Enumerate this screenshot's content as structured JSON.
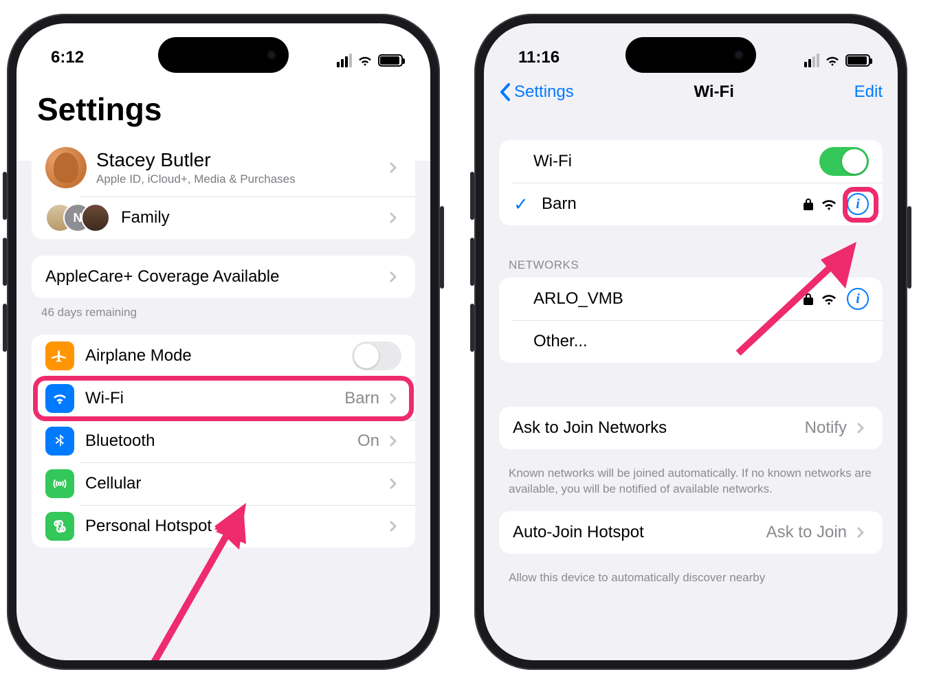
{
  "left": {
    "status_time": "6:12",
    "title": "Settings",
    "profile": {
      "name": "Stacey Butler",
      "subtitle": "Apple ID, iCloud+, Media & Purchases"
    },
    "family_label": "Family",
    "applecare": {
      "label": "AppleCare+ Coverage Available",
      "remaining": "46 days remaining"
    },
    "rows": {
      "airplane": "Airplane Mode",
      "wifi": "Wi-Fi",
      "wifi_value": "Barn",
      "bluetooth": "Bluetooth",
      "bluetooth_value": "On",
      "cellular": "Cellular",
      "hotspot": "Personal Hotspot"
    }
  },
  "right": {
    "status_time": "11:16",
    "nav_back": "Settings",
    "nav_title": "Wi-Fi",
    "nav_edit": "Edit",
    "wifi_toggle_label": "Wi-Fi",
    "connected_network": "Barn",
    "section_networks": "Networks",
    "networks": {
      "arlo": "ARLO_VMB",
      "other": "Other..."
    },
    "ask_join": {
      "label": "Ask to Join Networks",
      "value": "Notify",
      "footer": "Known networks will be joined automatically. If no known networks are available, you will be notified of available networks."
    },
    "auto_hotspot": {
      "label": "Auto-Join Hotspot",
      "value": "Ask to Join",
      "footer": "Allow this device to automatically discover nearby"
    }
  }
}
